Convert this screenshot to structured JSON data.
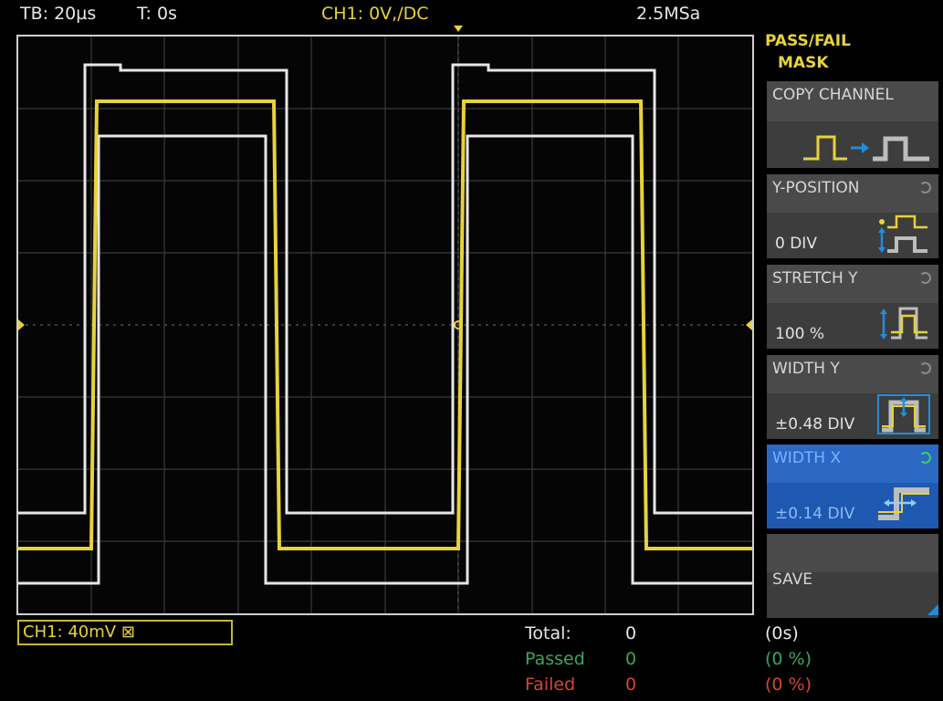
{
  "status_bar": {
    "timebase": "TB: 20µs",
    "trigger_time": "T: 0s",
    "channel": "CH1: 0V,/DC",
    "sample_rate": "2.5MSa"
  },
  "channel_box": "CH1: 40mV ⊠",
  "stats": {
    "total_label": "Total:",
    "total_value": "0",
    "total_pct": "(0s)",
    "passed_label": "Passed",
    "passed_value": "0",
    "passed_pct": "(0 %)",
    "failed_label": "Failed",
    "failed_value": "0",
    "failed_pct": "(0 %)"
  },
  "menu": {
    "title_line1": "PASS/FAIL",
    "title_line2": "MASK",
    "copy_channel": "COPY CHANNEL",
    "y_position": {
      "label": "Y-POSITION",
      "value": "0 DIV"
    },
    "stretch_y": {
      "label": "STRETCH Y",
      "value": "100 %"
    },
    "width_y": {
      "label": "WIDTH Y",
      "value": "±0.48 DIV"
    },
    "width_x": {
      "label": "WIDTH X",
      "value": "±0.14 DIV"
    },
    "save": "SAVE"
  },
  "colors": {
    "signal": "#e8d23a",
    "mask": "#e6e6e6",
    "grid": "#3a3a3a",
    "active_menu": "#1e58b0",
    "passed": "#3aa65a",
    "failed": "#d9452f"
  }
}
